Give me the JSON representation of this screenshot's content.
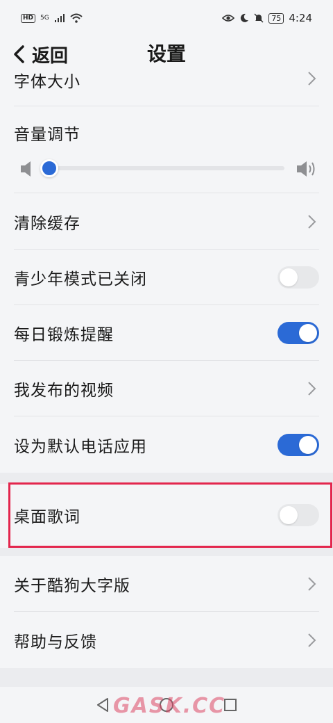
{
  "status_bar": {
    "hd": "HD",
    "signal": "5G",
    "battery": "75",
    "time": "4:24"
  },
  "header": {
    "back_label": "返回",
    "title": "设置"
  },
  "settings": {
    "font_size": {
      "label": "字体大小"
    },
    "volume": {
      "label": "音量调节",
      "level": 0.0
    },
    "clear_cache": {
      "label": "清除缓存"
    },
    "teen_mode": {
      "label": "青少年模式已关闭",
      "on": false
    },
    "daily_reminder": {
      "label": "每日锻炼提醒",
      "on": true
    },
    "my_videos": {
      "label": "我发布的视频"
    },
    "default_phone": {
      "label": "设为默认电话应用",
      "on": true
    },
    "desktop_lyrics": {
      "label": "桌面歌词",
      "on": false
    },
    "about": {
      "label": "关于酷狗大字版"
    },
    "help": {
      "label": "帮助与反馈"
    }
  },
  "watermark": "GASK.CC",
  "colors": {
    "accent": "#2b6ad6",
    "highlight": "#e3264d",
    "background": "#f4f5f7"
  }
}
